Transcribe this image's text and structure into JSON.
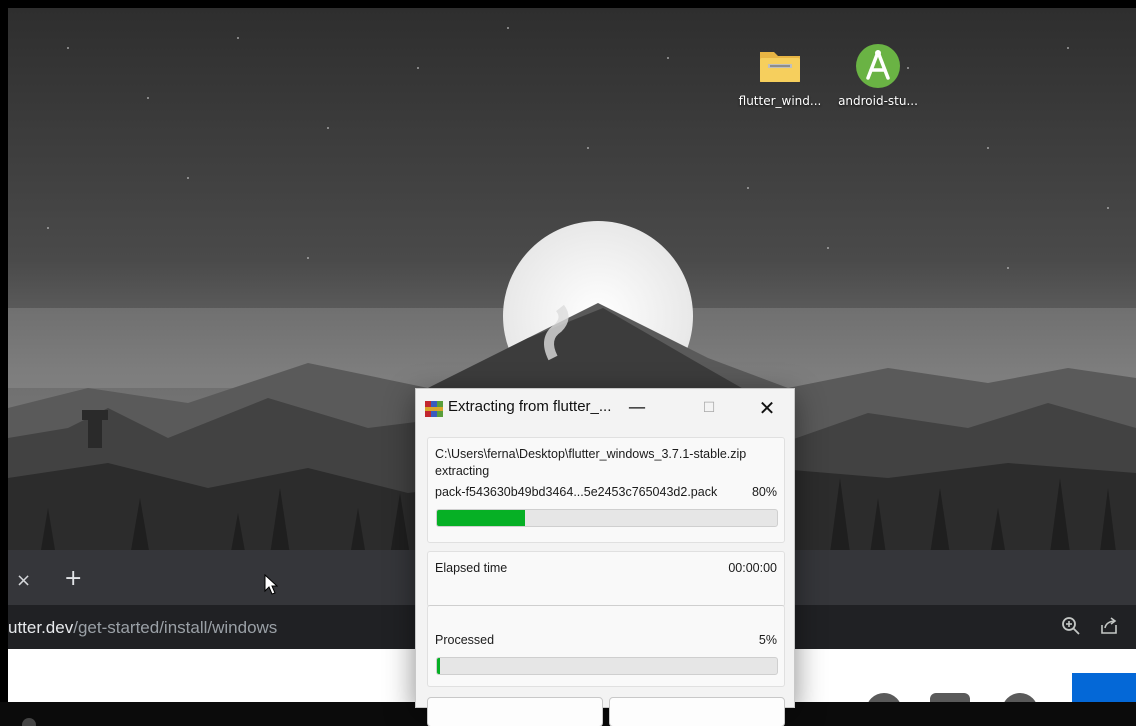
{
  "desktop": {
    "icons": [
      {
        "label": "flutter_wind...",
        "icon": "zip-folder-icon"
      },
      {
        "label": "android-stu...",
        "icon": "android-studio-icon"
      }
    ]
  },
  "browser": {
    "tab_close_glyph": "×",
    "new_tab_glyph": "+",
    "url_host": "utter.dev",
    "url_path": "/get-started/install/windows",
    "zoom_icon": "zoom-in-icon",
    "share_icon": "share-icon"
  },
  "dialog": {
    "title": "Extracting from flutter_...",
    "minimize_glyph": "—",
    "maximize_glyph": "☐",
    "close_glyph": "✕",
    "archive_path": "C:\\Users\\ferna\\Desktop\\flutter_windows_3.7.1-stable.zip",
    "action": "extracting",
    "current_file": "pack-f543630b49bd3464...5e2453c765043d2.pack",
    "file_percent_label": "80%",
    "file_progress": 0.26,
    "elapsed_label": "Elapsed time",
    "elapsed_value": "00:00:00",
    "processed_label": "Processed",
    "processed_percent_label": "5%",
    "processed_progress": 0.01
  },
  "colors": {
    "progress_green": "#06b025",
    "browser_tabstrip": "#35363a",
    "browser_omnibox": "#202124"
  }
}
